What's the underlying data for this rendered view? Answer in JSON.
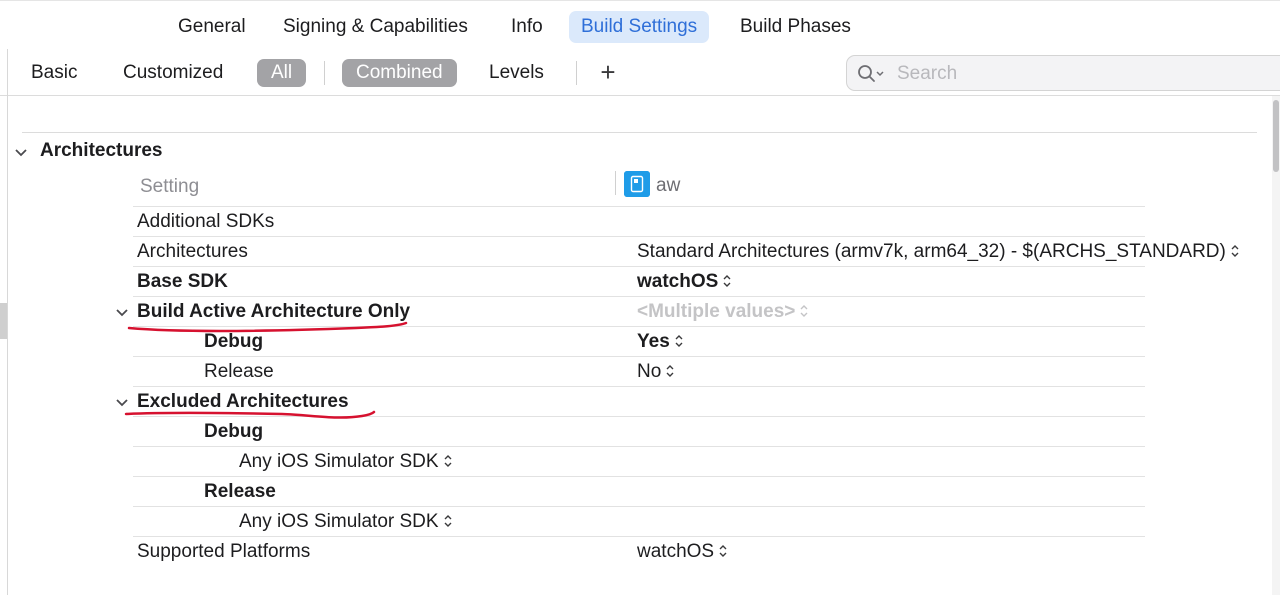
{
  "top_tabs": [
    {
      "label": "General",
      "active": false
    },
    {
      "label": "Signing & Capabilities",
      "active": false
    },
    {
      "label": "Info",
      "active": false
    },
    {
      "label": "Build Settings",
      "active": true
    },
    {
      "label": "Build Phases",
      "active": false
    }
  ],
  "filters": {
    "basic": "Basic",
    "customized": "Customized",
    "all": "All",
    "combined": "Combined",
    "levels": "Levels",
    "add": "+"
  },
  "search": {
    "placeholder": "Search",
    "value": ""
  },
  "section": {
    "title": "Architectures"
  },
  "header": {
    "setting_label": "Setting",
    "target_name": "aw",
    "target_icon": "target-document-icon"
  },
  "rows": [
    {
      "label": "Additional SDKs",
      "value": ""
    },
    {
      "label": "Architectures",
      "value": "Standard Architectures (armv7k, arm64_32)  -  $(ARCHS_STANDARD)"
    },
    {
      "label": "Base SDK",
      "value": "watchOS"
    },
    {
      "label": "Build Active Architecture Only",
      "value": "<Multiple values>"
    },
    {
      "label": "Debug",
      "value": "Yes"
    },
    {
      "label": "Release",
      "value": "No"
    },
    {
      "label": "Excluded Architectures",
      "value": ""
    },
    {
      "label": "Debug",
      "value": ""
    },
    {
      "label": "Any iOS Simulator SDK",
      "value": ""
    },
    {
      "label": "Release",
      "value": ""
    },
    {
      "label": "Any iOS Simulator SDK",
      "value": ""
    },
    {
      "label": "Supported Platforms",
      "value": "watchOS"
    }
  ],
  "colors": {
    "accent": "#2f6fd8",
    "active_tab_bg": "#dbe9fb",
    "pill_bg": "#a3a3a6",
    "annotation_red": "#d6112f",
    "target_icon": "#1f9ce8"
  }
}
